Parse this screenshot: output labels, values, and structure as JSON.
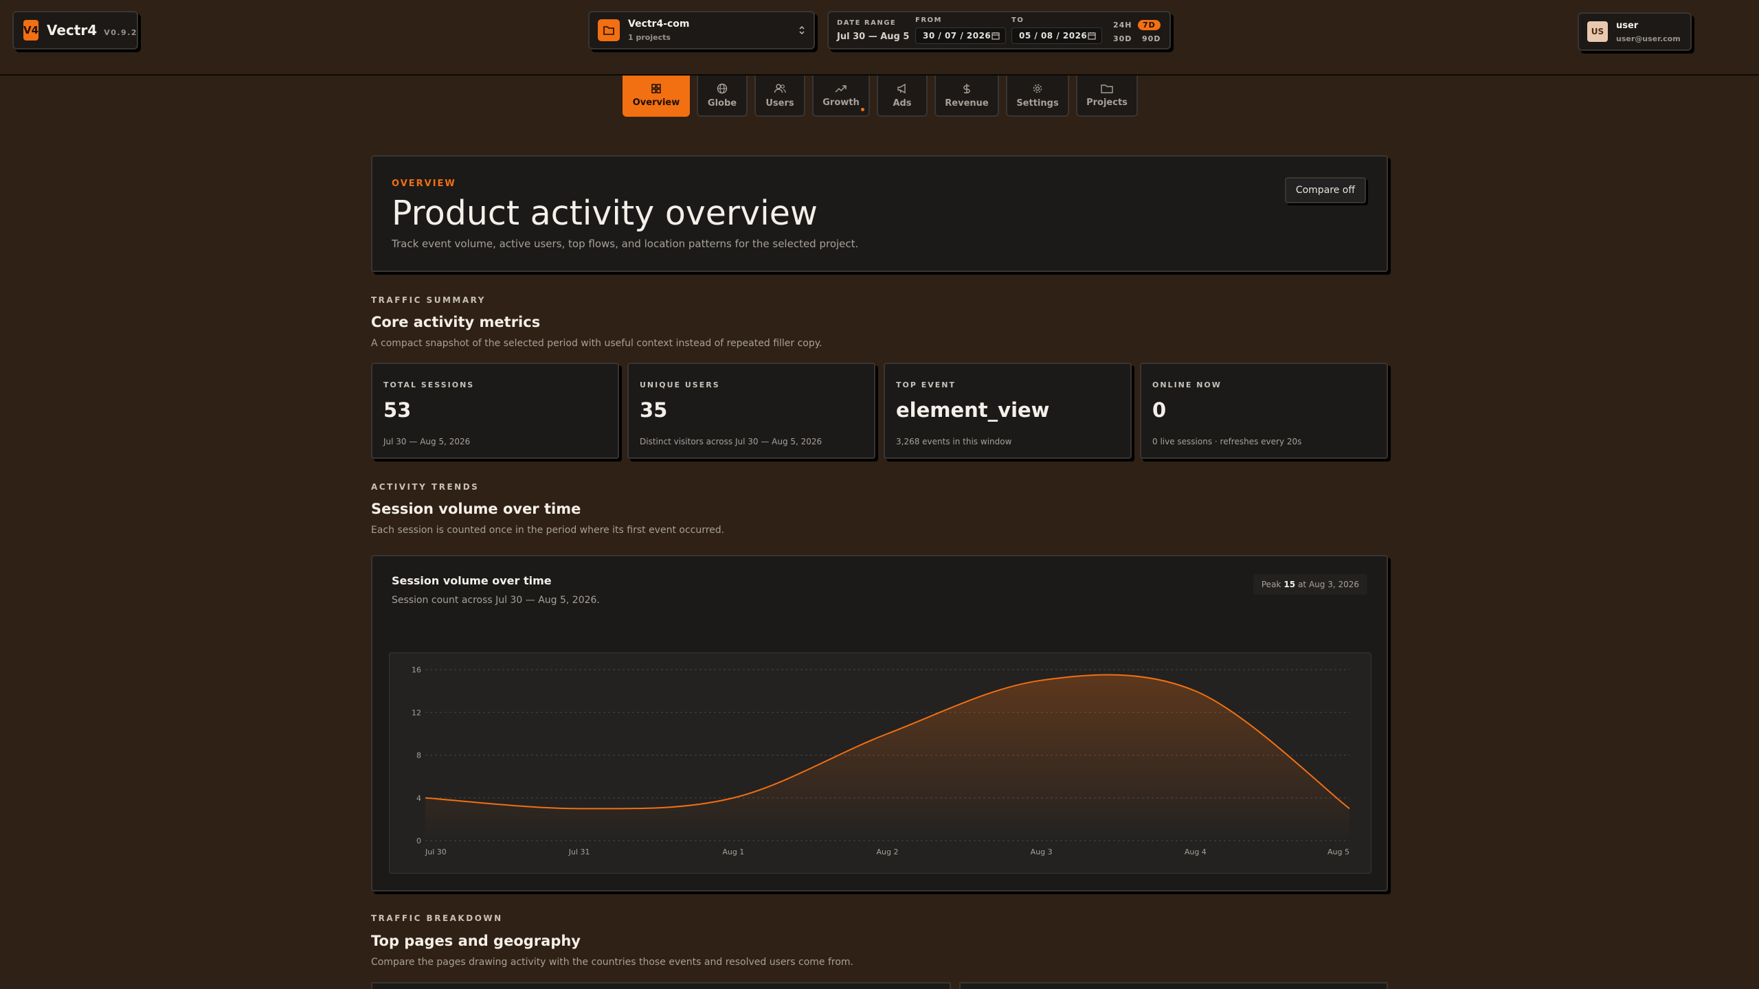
{
  "brand": {
    "badge": "V4",
    "name": "Vectr4",
    "version": "V0.9.2"
  },
  "project": {
    "name": "Vectr4-com",
    "count": "1 projects"
  },
  "date_range": {
    "label": "DATE RANGE",
    "value": "Jul 30 — Aug 5",
    "from_label": "FROM",
    "to_label": "TO",
    "from_value": "30 / 07 / 2026",
    "to_value": "05 / 08 / 2026",
    "presets": [
      "24H",
      "7D",
      "30D",
      "90D"
    ],
    "active_preset": "7D"
  },
  "user": {
    "initials": "US",
    "name": "user",
    "email": "user@user.com"
  },
  "tabs": [
    {
      "label": "Overview",
      "icon": "grid-icon"
    },
    {
      "label": "Globe",
      "icon": "globe-icon"
    },
    {
      "label": "Users",
      "icon": "users-icon"
    },
    {
      "label": "Growth",
      "icon": "trend-up-icon"
    },
    {
      "label": "Ads",
      "icon": "megaphone-icon"
    },
    {
      "label": "Revenue",
      "icon": "dollar-icon"
    },
    {
      "label": "Settings",
      "icon": "gear-icon"
    },
    {
      "label": "Projects",
      "icon": "folder-icon"
    }
  ],
  "hero": {
    "eyebrow": "OVERVIEW",
    "title": "Product activity overview",
    "description": "Track event volume, active users, top flows, and location patterns for the selected project.",
    "compare_label": "Compare off"
  },
  "traffic_summary": {
    "eyebrow": "TRAFFIC SUMMARY",
    "title": "Core activity metrics",
    "description": "A compact snapshot of the selected period with useful context instead of repeated filler copy."
  },
  "cards": [
    {
      "label": "TOTAL SESSIONS",
      "value": "53",
      "sub": "Jul 30 — Aug 5, 2026"
    },
    {
      "label": "UNIQUE USERS",
      "value": "35",
      "sub": "Distinct visitors across Jul 30 — Aug 5, 2026"
    },
    {
      "label": "TOP EVENT",
      "value": "element_view",
      "sub": "3,268 events in this window"
    },
    {
      "label": "ONLINE NOW",
      "value": "0",
      "sub": "0 live sessions · refreshes every 20s"
    }
  ],
  "activity_trends": {
    "eyebrow": "ACTIVITY TRENDS",
    "title": "Session volume over time",
    "description": "Each session is counted once in the period where its first event occurred."
  },
  "chart_panel": {
    "title": "Session volume over time",
    "subtitle": "Session count across Jul 30 — Aug 5, 2026.",
    "peak_prefix": "Peak",
    "peak_value": "15",
    "peak_suffix": "at Aug 3, 2026"
  },
  "chart_data": {
    "type": "area",
    "x": [
      "Jul 30",
      "Jul 31",
      "Aug 1",
      "Aug 2",
      "Aug 3",
      "Aug 4",
      "Aug 5"
    ],
    "series": [
      {
        "values": [
          4,
          3,
          4,
          10,
          15,
          14,
          3
        ]
      }
    ],
    "yticks": [
      0,
      4,
      8,
      12,
      16
    ],
    "ylim": [
      0,
      16
    ],
    "grid": true,
    "color": "#f26f12"
  },
  "traffic_breakdown": {
    "eyebrow": "TRAFFIC BREAKDOWN",
    "title": "Top pages and geography",
    "description": "Compare the pages drawing activity with the countries those events and resolved users come from."
  },
  "colors": {
    "accent": "#f26f12",
    "background": "#2f2115",
    "panel": "#1b1a19"
  }
}
